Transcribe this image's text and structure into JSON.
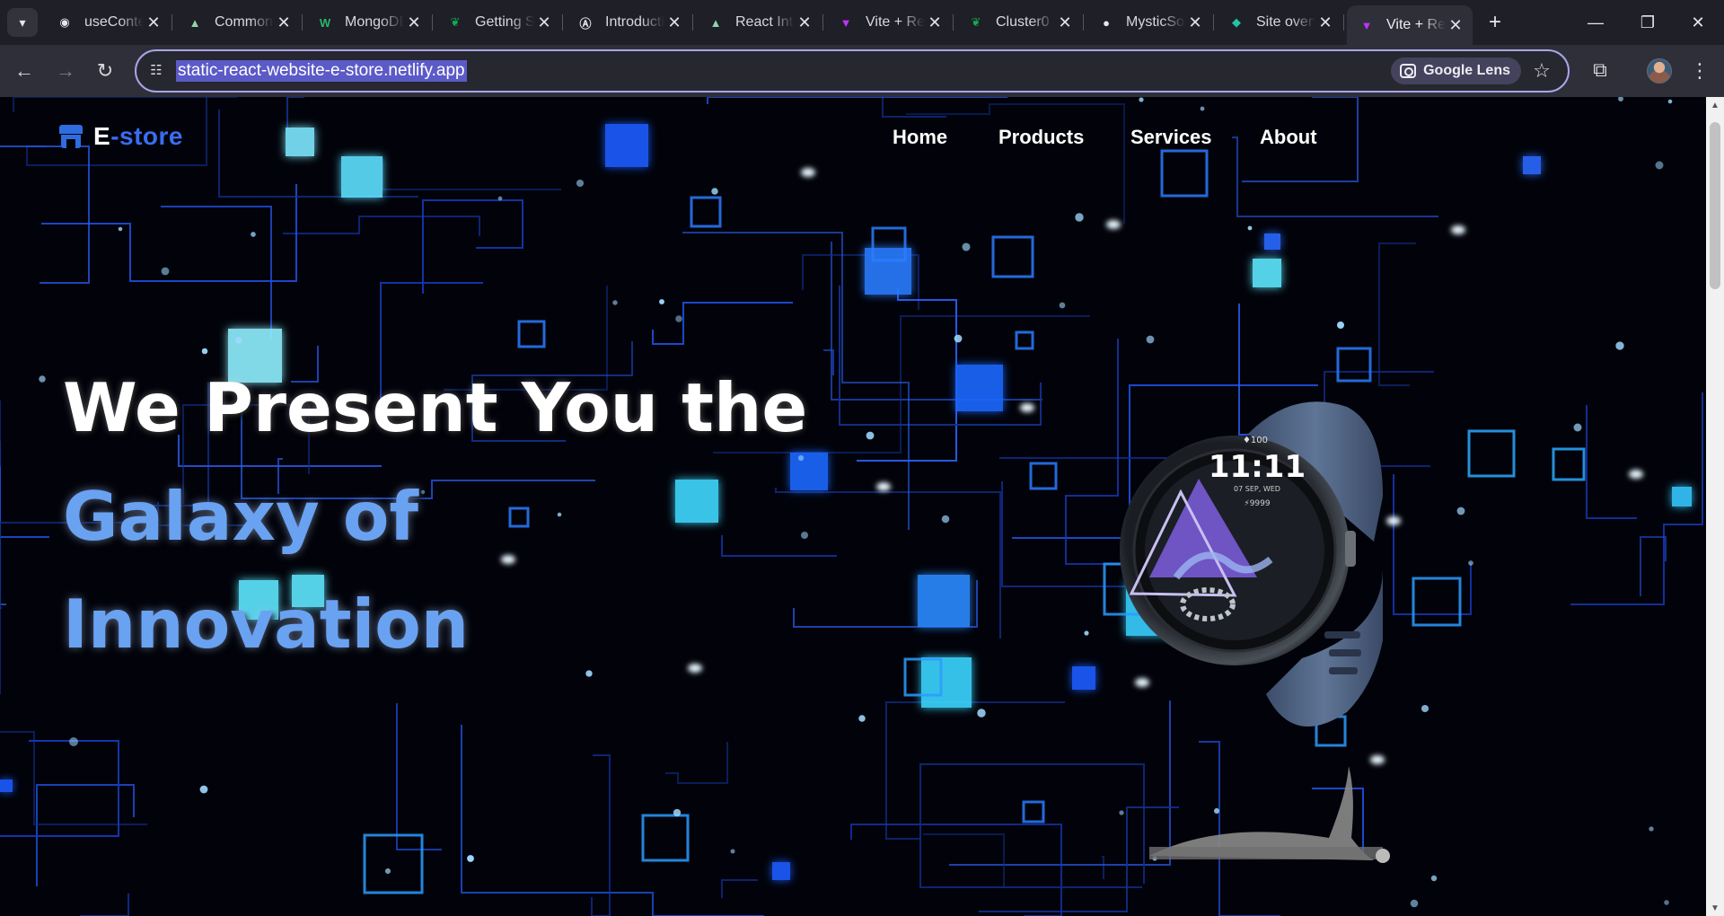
{
  "browser": {
    "tab_menu_icon": "chevron-down-icon",
    "tabs": [
      {
        "title": "useContext",
        "icon": "react-docs-icon",
        "color": "#e8e8ea",
        "active": false
      },
      {
        "title": "Common",
        "icon": "mountain-icon",
        "color": "#8fd6a8",
        "active": false
      },
      {
        "title": "MongoDB",
        "icon": "w3schools-icon",
        "color": "#26b86a",
        "active": false
      },
      {
        "title": "Getting Started",
        "icon": "mongodb-leaf-icon",
        "color": "#13aa52",
        "active": false
      },
      {
        "title": "Introduction",
        "icon": "nextjs-icon",
        "color": "#e8e8ea",
        "active": false
      },
      {
        "title": "React Interview",
        "icon": "mountain-icon",
        "color": "#8fd6a8",
        "active": false
      },
      {
        "title": "Vite + React",
        "icon": "vite-icon",
        "color": "#bd34fe",
        "active": false
      },
      {
        "title": "Cluster0",
        "icon": "mongodb-leaf-icon",
        "color": "#13aa52",
        "active": false
      },
      {
        "title": "MysticSoul",
        "icon": "github-icon",
        "color": "#e8e8ea",
        "active": false
      },
      {
        "title": "Site overview",
        "icon": "netlify-icon",
        "color": "#25c2a0",
        "active": false
      },
      {
        "title": "Vite + React",
        "icon": "vite-icon",
        "color": "#bd34fe",
        "active": true
      }
    ],
    "new_tab_label": "+",
    "window_controls": {
      "minimize": "—",
      "restore": "❐",
      "close": "✕"
    },
    "nav": {
      "back": "←",
      "forward": "→",
      "reload": "↻"
    },
    "url": "static-react-website-e-store.netlify.app",
    "lens_label": "Google Lens",
    "bookmark_icon": "star-icon",
    "extensions_icon": "puzzle-icon",
    "menu_icon": "kebab-icon"
  },
  "site": {
    "brand": {
      "initial": "E",
      "rest": "-store"
    },
    "nav": [
      "Home",
      "Products",
      "Services",
      "About"
    ],
    "hero": {
      "line1": "We Present You the",
      "line2": "Galaxy of",
      "line3": "Innovation"
    },
    "watch_face": {
      "top": "♦100",
      "time": "11:11",
      "date": "07 SEP, WED",
      "steps": "⚡9999"
    },
    "colors": {
      "accent": "#3a6df0",
      "hero_highlight": "#6aa2f2",
      "background": "#02030a",
      "circuit": "#1a4dd8",
      "glow": "#35d9ff"
    }
  }
}
